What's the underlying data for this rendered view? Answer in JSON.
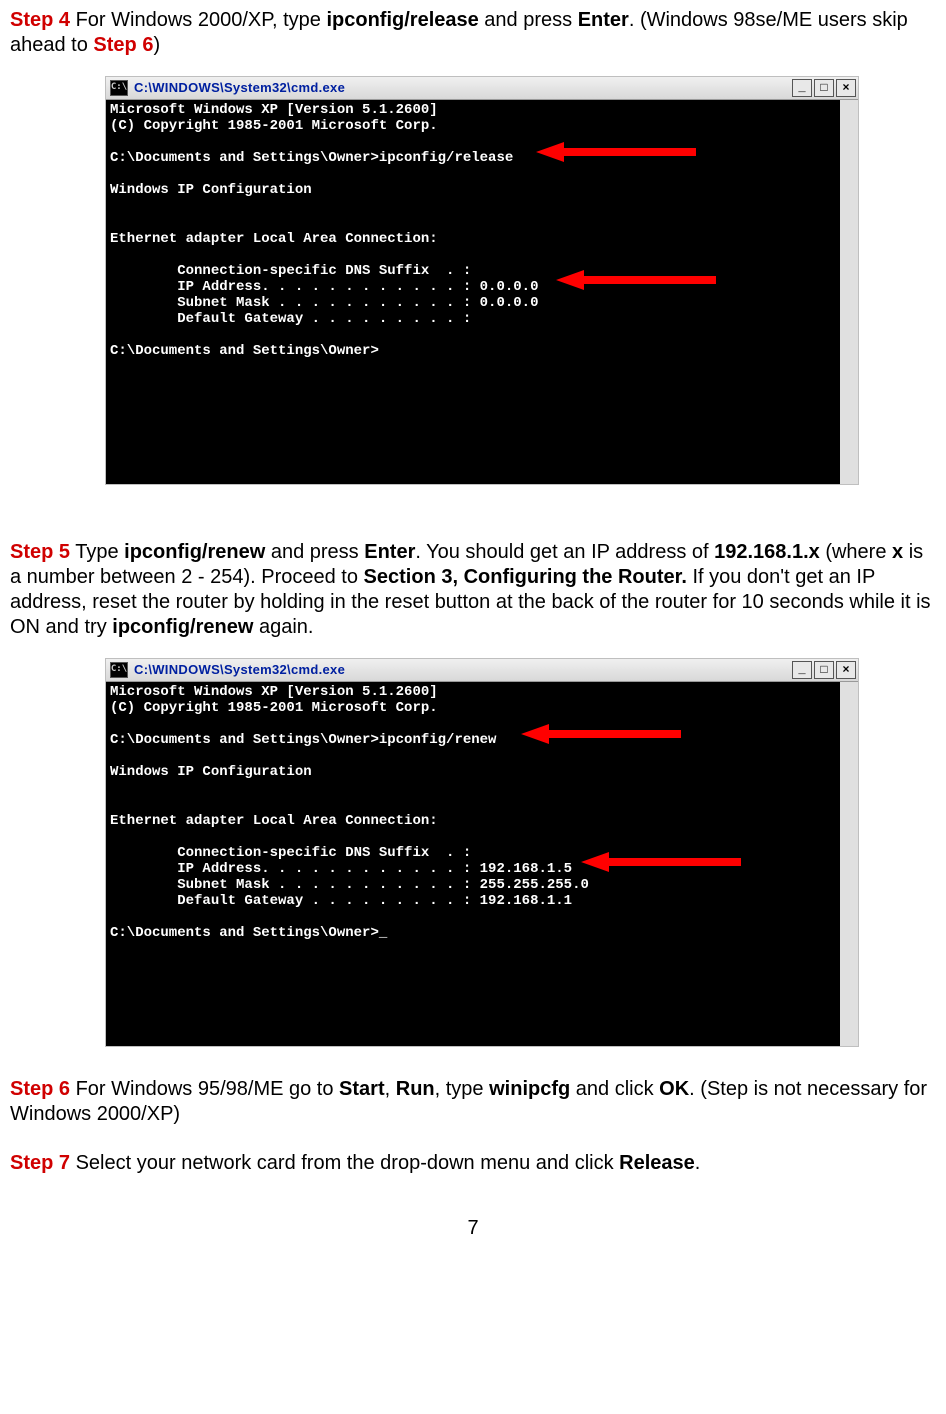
{
  "page_number": "7",
  "steps": {
    "s4": {
      "label": "Step 4",
      "pre": " For Windows 2000/XP, type ",
      "kw1": "ipconfig/release",
      "mid": " and press ",
      "kw2": "Enter",
      "post": ". (Windows 98se/ME users skip ahead to ",
      "link": "Step 6",
      "end": ")"
    },
    "s5": {
      "label": "Step 5",
      "a": " Type ",
      "kw1": "ipconfig/renew",
      "b": " and press ",
      "kw2": "Enter",
      "c": ". You should get an IP address of ",
      "kw3": "192.168.1.x",
      "d": " (where ",
      "kw4": "x",
      "e": " is a number between 2 - 254). Proceed to ",
      "kw5": "Section 3, Configuring the Router.",
      "f": " If you don't get an IP address, reset the router by holding in the reset button at the back of the router for 10 seconds while it is ON and try ",
      "kw6": "ipconfig/renew",
      "g": " again."
    },
    "s6": {
      "label": "Step 6",
      "a": " For Windows 95/98/ME go to ",
      "kw1": "Start",
      "b": ", ",
      "kw2": "Run",
      "c": ", type ",
      "kw3": "winipcfg",
      "d": " and click ",
      "kw4": "OK",
      "e": ". (Step is not necessary for Windows 2000/XP)"
    },
    "s7": {
      "label": "Step 7",
      "a": " Select your network card from the drop-down menu and click ",
      "kw1": "Release",
      "b": "."
    }
  },
  "cmd1": {
    "title": "C:\\WINDOWS\\System32\\cmd.exe",
    "icon_text": "C:\\",
    "lines": [
      "Microsoft Windows XP [Version 5.1.2600]",
      "(C) Copyright 1985-2001 Microsoft Corp.",
      "",
      "C:\\Documents and Settings\\Owner>ipconfig/release",
      "",
      "Windows IP Configuration",
      "",
      "",
      "Ethernet adapter Local Area Connection:",
      "",
      "        Connection-specific DNS Suffix  . :",
      "        IP Address. . . . . . . . . . . . : 0.0.0.0",
      "        Subnet Mask . . . . . . . . . . . : 0.0.0.0",
      "        Default Gateway . . . . . . . . . :",
      "",
      "C:\\Documents and Settings\\Owner>"
    ]
  },
  "cmd2": {
    "title": "C:\\WINDOWS\\System32\\cmd.exe",
    "icon_text": "C:\\",
    "lines": [
      "Microsoft Windows XP [Version 5.1.2600]",
      "(C) Copyright 1985-2001 Microsoft Corp.",
      "",
      "C:\\Documents and Settings\\Owner>ipconfig/renew",
      "",
      "Windows IP Configuration",
      "",
      "",
      "Ethernet adapter Local Area Connection:",
      "",
      "        Connection-specific DNS Suffix  . :",
      "        IP Address. . . . . . . . . . . . : 192.168.1.5",
      "        Subnet Mask . . . . . . . . . . . : 255.255.255.0",
      "        Default Gateway . . . . . . . . . : 192.168.1.1",
      "",
      "C:\\Documents and Settings\\Owner>_"
    ]
  },
  "winbtn": {
    "min": "_",
    "max": "□",
    "close": "×"
  }
}
